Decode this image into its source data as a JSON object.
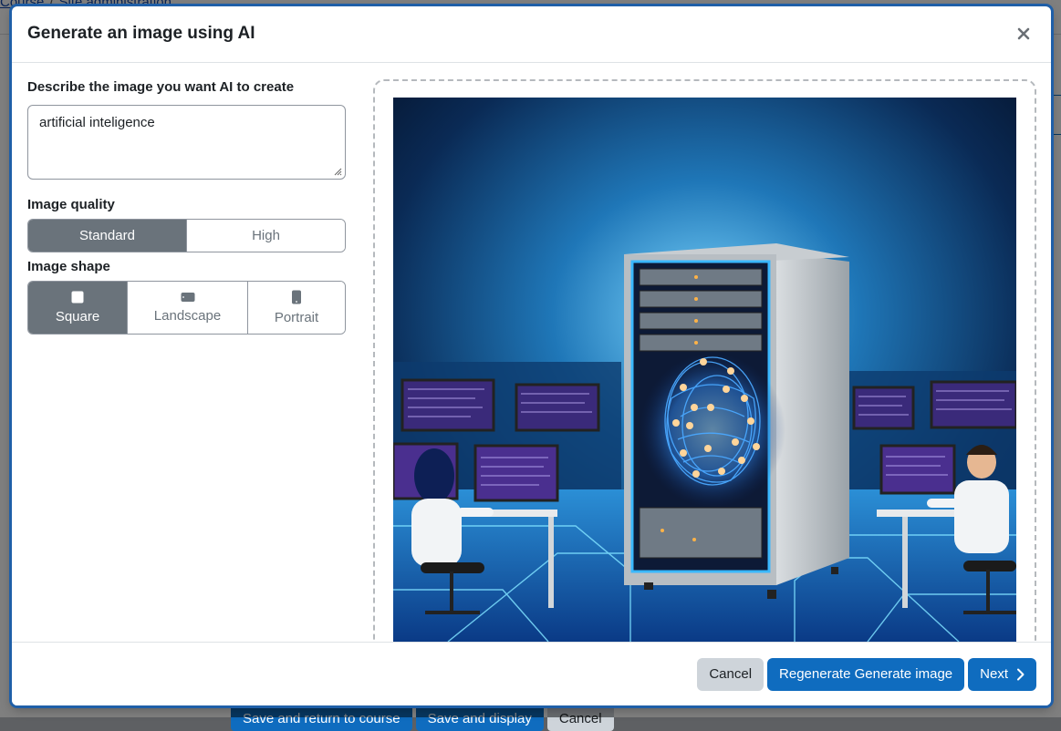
{
  "background": {
    "breadcrumb": [
      "Course",
      "Site administration"
    ],
    "footer_buttons": [
      "Save and return to course",
      "Save and display",
      "Cancel"
    ]
  },
  "modal": {
    "title": "Generate an image using AI",
    "close_icon": "close-icon",
    "prompt_label": "Describe the image you want AI to create",
    "prompt_value": "artificial inteligence",
    "quality_label": "Image quality",
    "quality_options": [
      "Standard",
      "High"
    ],
    "quality_selected": "Standard",
    "shape_label": "Image shape",
    "shape_options": [
      {
        "label": "Square",
        "icon": "square-icon"
      },
      {
        "label": "Landscape",
        "icon": "landscape-icon"
      },
      {
        "label": "Portrait",
        "icon": "portrait-icon"
      }
    ],
    "shape_selected": "Square",
    "preview_alt": "AI generated image: server rack containing a glowing brain, with two scientists at computer workstations",
    "footer": {
      "cancel": "Cancel",
      "regenerate": "Regenerate Generate image",
      "next": "Next",
      "next_icon": "chevron-right-icon"
    }
  },
  "colors": {
    "primary": "#0f6cbf",
    "segment_active": "#6a737b",
    "secondary": "#ced4da"
  }
}
